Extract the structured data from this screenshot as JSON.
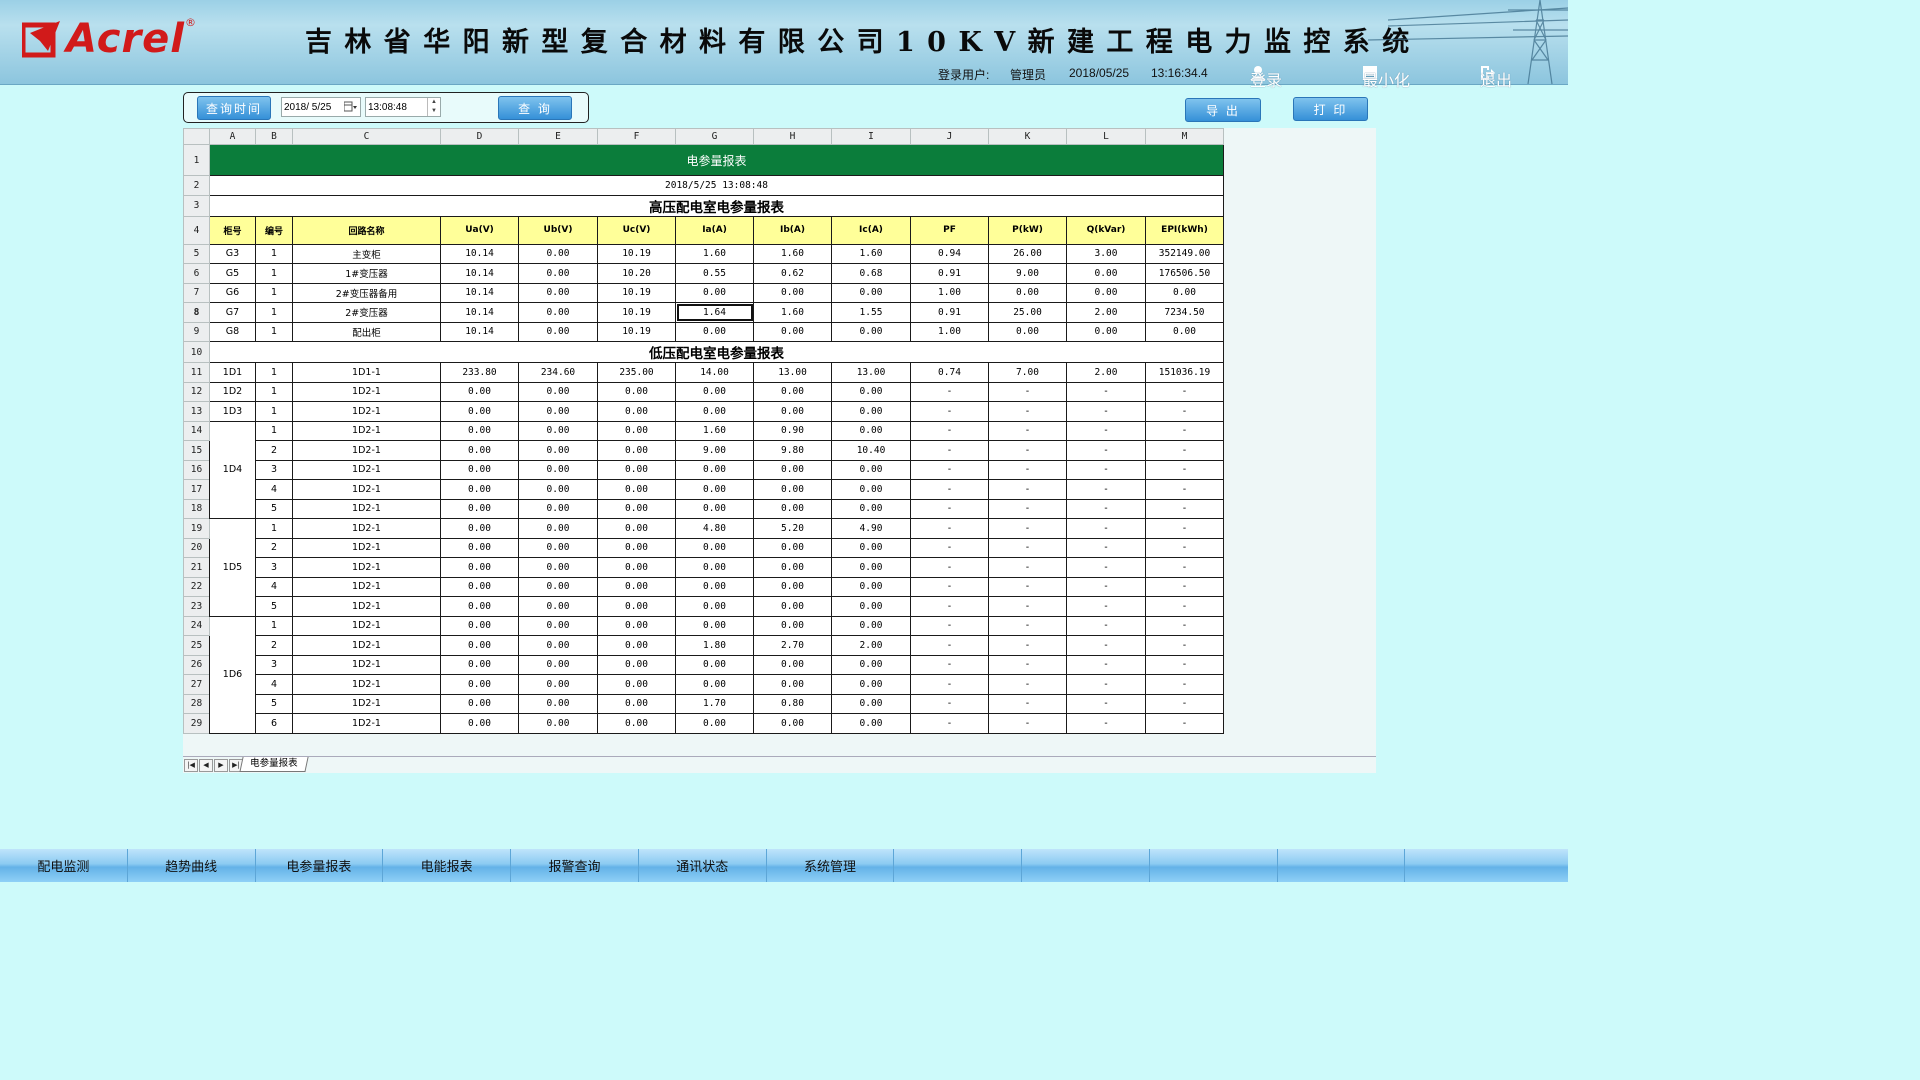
{
  "header": {
    "brand": "Acrel",
    "brand_mark": "®",
    "title": "吉林省华阳新型复合材料有限公司10KV新建工程电力监控系统",
    "login_label": "登录用户:",
    "user": "管理员",
    "date": "2018/05/25",
    "time": "13:16:34.4",
    "login_button": "登录",
    "minimize_button": "最小化",
    "exit_button": "退出"
  },
  "query": {
    "label_button": "查询时间",
    "date_value": "2018/ 5/25",
    "time_value": "13:08:48",
    "query_button": "查 询",
    "export_button": "导 出",
    "print_button": "打 印"
  },
  "sheet": {
    "columns": [
      "A",
      "B",
      "C",
      "D",
      "E",
      "F",
      "G",
      "H",
      "I",
      "J",
      "K",
      "L",
      "M"
    ],
    "row_numbers": [
      "1",
      "2",
      "3",
      "4",
      "5",
      "6",
      "7",
      "8",
      "9",
      "10",
      "11",
      "12",
      "13",
      "14",
      "15",
      "16",
      "17",
      "18",
      "19",
      "20",
      "21",
      "22",
      "23",
      "24",
      "25",
      "26",
      "27",
      "28",
      "29"
    ],
    "report_title": "电参量报表",
    "report_datetime": "2018/5/25 13:08:48",
    "hv_section_title": "高压配电室电参量报表",
    "lv_section_title": "低压配电室电参量报表",
    "headers": [
      "柜号",
      "编号",
      "回路名称",
      "Ua(V)",
      "Ub(V)",
      "Uc(V)",
      "Ia(A)",
      "Ib(A)",
      "Ic(A)",
      "PF",
      "P(kW)",
      "Q(kVar)",
      "EPI(kWh)"
    ],
    "hv_rows": [
      [
        "G3",
        "1",
        "主变柜",
        "10.14",
        "0.00",
        "10.19",
        "1.60",
        "1.60",
        "1.60",
        "0.94",
        "26.00",
        "3.00",
        "352149.00"
      ],
      [
        "G5",
        "1",
        "1#变压器",
        "10.14",
        "0.00",
        "10.20",
        "0.55",
        "0.62",
        "0.68",
        "0.91",
        "9.00",
        "0.00",
        "176506.50"
      ],
      [
        "G6",
        "1",
        "2#变压器备用",
        "10.14",
        "0.00",
        "10.19",
        "0.00",
        "0.00",
        "0.00",
        "1.00",
        "0.00",
        "0.00",
        "0.00"
      ],
      [
        "G7",
        "1",
        "2#变压器",
        "10.14",
        "0.00",
        "10.19",
        "1.64",
        "1.60",
        "1.55",
        "0.91",
        "25.00",
        "2.00",
        "7234.50"
      ],
      [
        "G8",
        "1",
        "配出柜",
        "10.14",
        "0.00",
        "10.19",
        "0.00",
        "0.00",
        "0.00",
        "1.00",
        "0.00",
        "0.00",
        "0.00"
      ]
    ],
    "lv_rows": [
      [
        "1D1",
        "1",
        "1D1-1",
        "233.80",
        "234.60",
        "235.00",
        "14.00",
        "13.00",
        "13.00",
        "0.74",
        "7.00",
        "2.00",
        "151036.19"
      ],
      [
        "1D2",
        "1",
        "1D2-1",
        "0.00",
        "0.00",
        "0.00",
        "0.00",
        "0.00",
        "0.00",
        "-",
        "-",
        "-",
        "-"
      ],
      [
        "1D3",
        "1",
        "1D2-1",
        "0.00",
        "0.00",
        "0.00",
        "0.00",
        "0.00",
        "0.00",
        "-",
        "-",
        "-",
        "-"
      ],
      [
        "1D4",
        "1",
        "1D2-1",
        "0.00",
        "0.00",
        "0.00",
        "1.60",
        "0.90",
        "0.00",
        "-",
        "-",
        "-",
        "-"
      ],
      [
        "",
        "2",
        "1D2-1",
        "0.00",
        "0.00",
        "0.00",
        "9.00",
        "9.80",
        "10.40",
        "-",
        "-",
        "-",
        "-"
      ],
      [
        "",
        "3",
        "1D2-1",
        "0.00",
        "0.00",
        "0.00",
        "0.00",
        "0.00",
        "0.00",
        "-",
        "-",
        "-",
        "-"
      ],
      [
        "",
        "4",
        "1D2-1",
        "0.00",
        "0.00",
        "0.00",
        "0.00",
        "0.00",
        "0.00",
        "-",
        "-",
        "-",
        "-"
      ],
      [
        "",
        "5",
        "1D2-1",
        "0.00",
        "0.00",
        "0.00",
        "0.00",
        "0.00",
        "0.00",
        "-",
        "-",
        "-",
        "-"
      ],
      [
        "1D5",
        "1",
        "1D2-1",
        "0.00",
        "0.00",
        "0.00",
        "4.80",
        "5.20",
        "4.90",
        "-",
        "-",
        "-",
        "-"
      ],
      [
        "",
        "2",
        "1D2-1",
        "0.00",
        "0.00",
        "0.00",
        "0.00",
        "0.00",
        "0.00",
        "-",
        "-",
        "-",
        "-"
      ],
      [
        "",
        "3",
        "1D2-1",
        "0.00",
        "0.00",
        "0.00",
        "0.00",
        "0.00",
        "0.00",
        "-",
        "-",
        "-",
        "-"
      ],
      [
        "",
        "4",
        "1D2-1",
        "0.00",
        "0.00",
        "0.00",
        "0.00",
        "0.00",
        "0.00",
        "-",
        "-",
        "-",
        "-"
      ],
      [
        "",
        "5",
        "1D2-1",
        "0.00",
        "0.00",
        "0.00",
        "0.00",
        "0.00",
        "0.00",
        "-",
        "-",
        "-",
        "-"
      ],
      [
        "1D6",
        "1",
        "1D2-1",
        "0.00",
        "0.00",
        "0.00",
        "0.00",
        "0.00",
        "0.00",
        "-",
        "-",
        "-",
        "-"
      ],
      [
        "",
        "2",
        "1D2-1",
        "0.00",
        "0.00",
        "0.00",
        "1.80",
        "2.70",
        "2.00",
        "-",
        "-",
        "-",
        "-"
      ],
      [
        "",
        "3",
        "1D2-1",
        "0.00",
        "0.00",
        "0.00",
        "0.00",
        "0.00",
        "0.00",
        "-",
        "-",
        "-",
        "-"
      ],
      [
        "",
        "4",
        "1D2-1",
        "0.00",
        "0.00",
        "0.00",
        "0.00",
        "0.00",
        "0.00",
        "-",
        "-",
        "-",
        "-"
      ],
      [
        "",
        "5",
        "1D2-1",
        "0.00",
        "0.00",
        "0.00",
        "1.70",
        "0.80",
        "0.00",
        "-",
        "-",
        "-",
        "-"
      ],
      [
        "",
        "6",
        "1D2-1",
        "0.00",
        "0.00",
        "0.00",
        "0.00",
        "0.00",
        "0.00",
        "-",
        "-",
        "-",
        "-"
      ]
    ],
    "sheet_tab": "电参量报表"
  },
  "nav": [
    "配电监测",
    "趋势曲线",
    "电参量报表",
    "电能报表",
    "报警查询",
    "通讯状态",
    "系统管理",
    "",
    "",
    "",
    "",
    ""
  ],
  "colors": {
    "background": "#cdfafa",
    "title_green": "#0b7d3b",
    "header_yellow": "#ffff99",
    "brand_red": "#d11a1a",
    "button_blue": "#3590d8"
  }
}
